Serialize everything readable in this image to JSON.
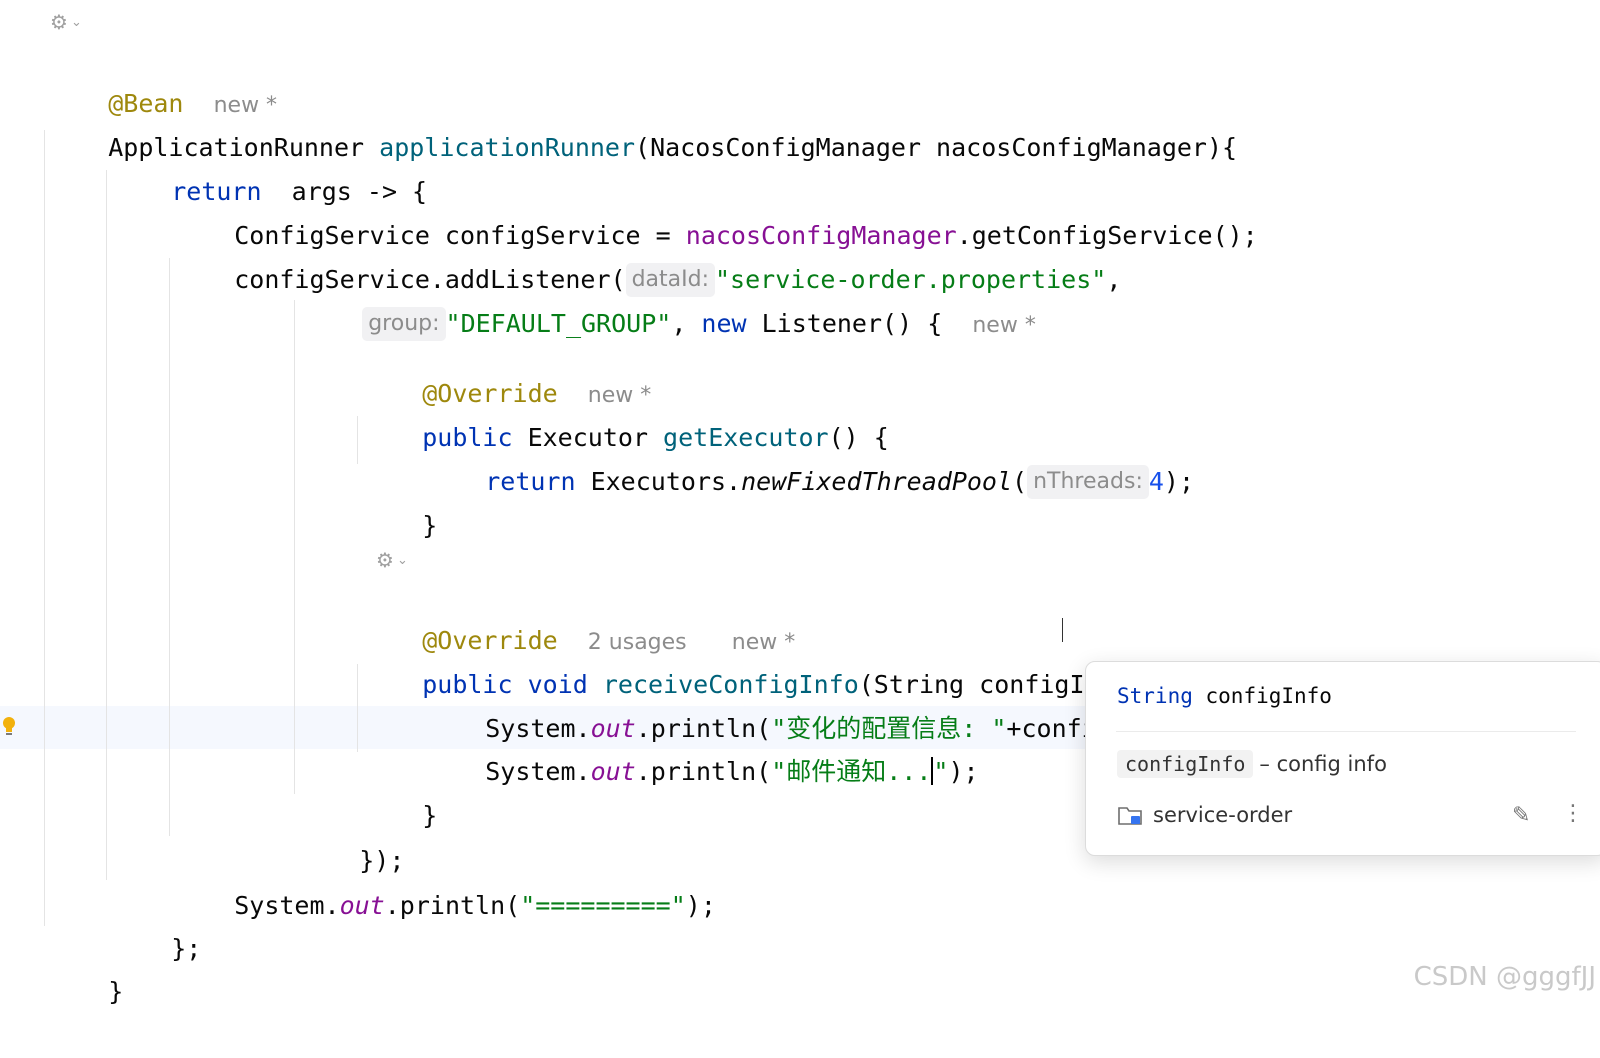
{
  "editor": {
    "hints": {
      "new": "new *",
      "usages": "2 usages",
      "dataId": "dataId:",
      "group": "group:",
      "nThreads": "nThreads:"
    },
    "tokens": {
      "bean": "@Bean",
      "appRunner": "ApplicationRunner",
      "appRunnerFn": "applicationRunner",
      "paramsOpen": "(NacosConfigManager nacosConfigManager){",
      "return": "return",
      "argsArrow": "args -> {",
      "configServiceType": "ConfigService configService = ",
      "nacosMgr": "nacosConfigManager",
      "getConfigService": ".getConfigService();",
      "addListener": "configService.addListener(",
      "dataIdValue": "\"service-order.properties\"",
      "comma": ",",
      "groupValue": "\"DEFAULT_GROUP\"",
      "commaSpace": ", ",
      "newKw": "new",
      "listener": " Listener() {",
      "override": "@Override",
      "public": "public",
      "executorType": " Executor ",
      "getExecutor": "getExecutor",
      "parensBrace": "() {",
      "executors": " Executors.",
      "newFixed": "newFixedThreadPool",
      "paren": "(",
      "four": "4",
      "closeSemi": ");",
      "closeBrace": "}",
      "void": "void",
      "receive": "receiveConfigInfo",
      "receiveParams": "(String configInfo) {",
      "system": "System.",
      "out": "out",
      "println": ".println(",
      "str1": "\"变化的配置信息: \"",
      "plusConfig": "+configI",
      "str2a": "\"邮件通知...",
      "str2b": "\"",
      "closeListener": "});",
      "eqStr": "\"=========\"",
      "closeLambda": "};"
    }
  },
  "popup": {
    "sig_type": "String",
    "sig_name": "configInfo",
    "doc_code": "configInfo",
    "doc_text": "– config info",
    "module": "service-order"
  },
  "icons": {
    "generate": "generate-icon",
    "bulb": "lightbulb-icon",
    "folder": "module-folder-icon",
    "edit": "edit-pencil-icon",
    "more": "more-vertical-icon"
  },
  "watermark": "CSDN @gggfJJ"
}
